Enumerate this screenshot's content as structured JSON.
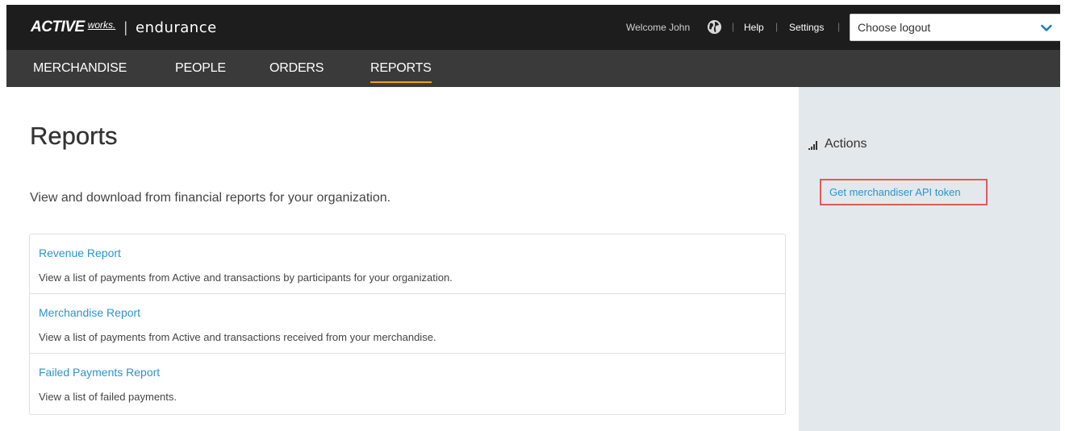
{
  "header": {
    "logo": {
      "brand": "ACTIVE",
      "brand_suffix": "works.",
      "separator": "|",
      "product": "endurance"
    },
    "welcome_text": "Welcome John",
    "globe_icon": "globe-icon",
    "separators": [
      "|",
      "|",
      "|"
    ],
    "help_label": "Help",
    "settings_label": "Settings",
    "logout_select": {
      "value": "Choose logout",
      "icon": "chevron-down-icon"
    }
  },
  "nav": {
    "items": [
      {
        "label": "MERCHANDISE",
        "active": false
      },
      {
        "label": "PEOPLE",
        "active": false
      },
      {
        "label": "ORDERS",
        "active": false
      },
      {
        "label": "REPORTS",
        "active": true
      }
    ]
  },
  "main": {
    "title": "Reports",
    "subtitle": "View and download from financial reports for your organization.",
    "reports": [
      {
        "name": "Revenue Report",
        "description": "View a list of payments from Active and transactions by participants for your organization."
      },
      {
        "name": "Merchandise Report",
        "description": "View a list of payments from Active and transactions received from your merchandise."
      },
      {
        "name": "Failed Payments Report",
        "description": "View a list of failed payments."
      }
    ]
  },
  "sidebar": {
    "actions_title": "Actions",
    "actions_icon": "signal-bars-icon",
    "actions": [
      {
        "label": "Get merchandiser API token",
        "highlighted": true
      }
    ]
  },
  "colors": {
    "topbar": "#1d1d1d",
    "navbar": "#3a3a3a",
    "nav_active_underline": "#f0a500",
    "link": "#2b95c9",
    "sidebar_bg": "#e3e8ec",
    "highlight_border": "#e05a5a",
    "dropdown_chevron": "#1e7fc0"
  }
}
